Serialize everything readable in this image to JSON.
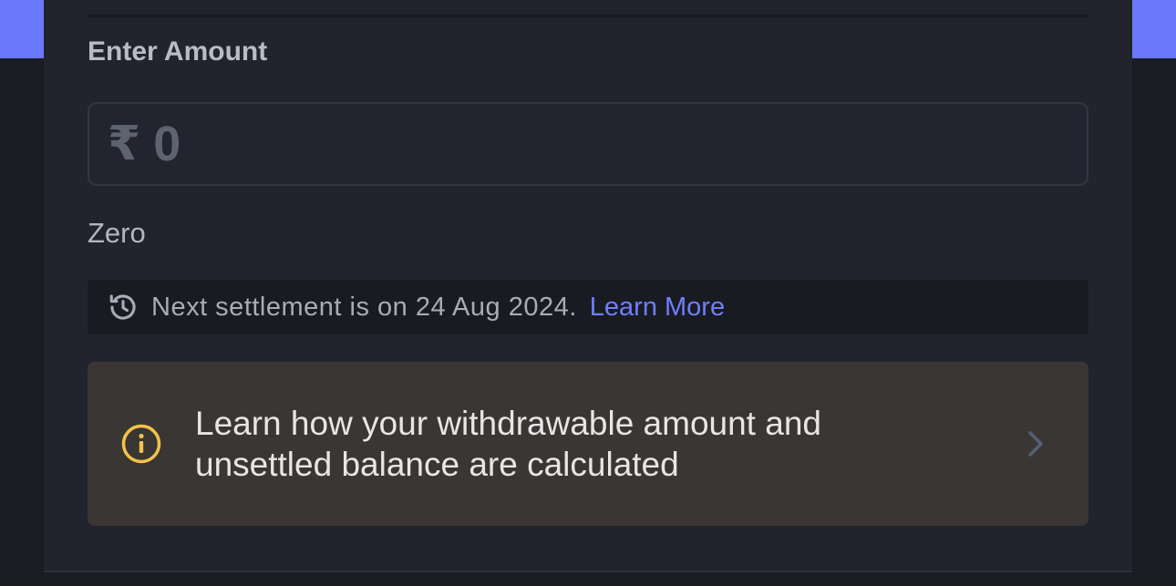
{
  "form": {
    "amount_label": "Enter Amount",
    "currency_symbol": "₹",
    "amount_placeholder": "0",
    "amount_in_words": "Zero"
  },
  "settlement": {
    "icon": "history-icon",
    "message": "Next settlement is on 24 Aug 2024.",
    "link_label": "Learn More"
  },
  "info_card": {
    "icon": "info-icon",
    "text": "Learn how your withdrawable amount and unsettled balance are calculated",
    "chevron_icon": "chevron-right-icon"
  },
  "colors": {
    "accent": "#6a78fb",
    "link": "#6f7ffb",
    "info_icon": "#f2c24a",
    "panel_bg": "#21242d",
    "card_bg": "#3a3634"
  }
}
